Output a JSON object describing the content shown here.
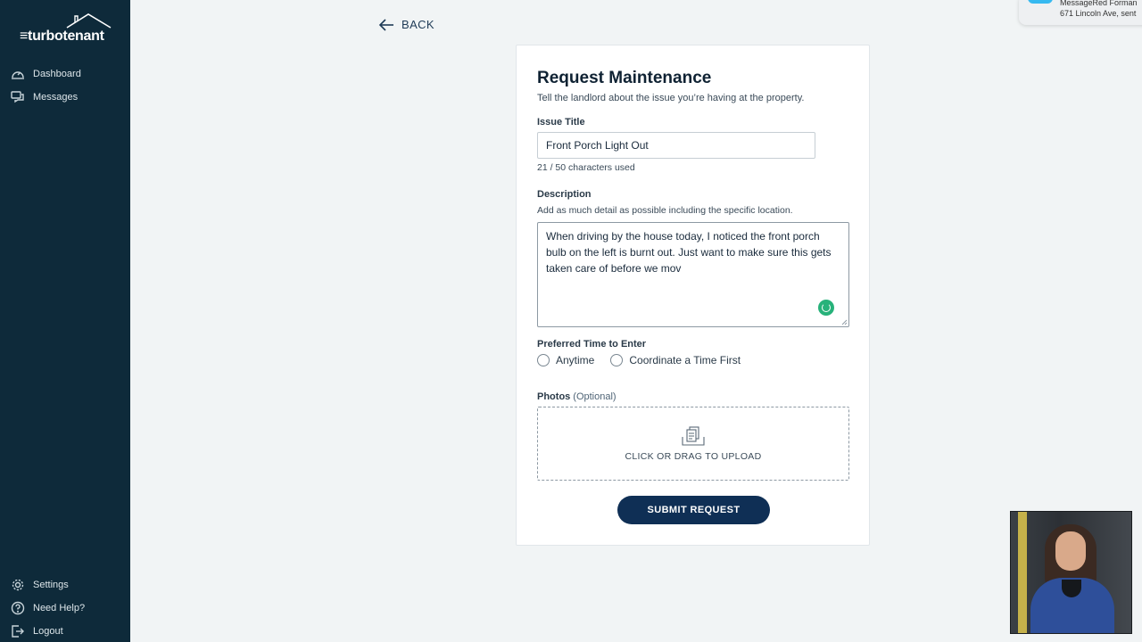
{
  "app": {
    "logo_text": "≡turbotenant"
  },
  "sidebar": {
    "top_items": [
      {
        "label": "Dashboard",
        "icon": "dashboard-icon"
      },
      {
        "label": "Messages",
        "icon": "messages-icon"
      }
    ],
    "bottom_items": [
      {
        "label": "Settings",
        "icon": "gear-icon"
      },
      {
        "label": "Need Help?",
        "icon": "help-icon"
      },
      {
        "label": "Logout",
        "icon": "logout-icon"
      }
    ]
  },
  "back_label": "BACK",
  "form": {
    "title": "Request Maintenance",
    "subtitle": "Tell the landlord about the issue you’re having at the property.",
    "issue_title": {
      "label": "Issue Title",
      "value": "Front Porch Light Out",
      "count": "21 / 50 characters used"
    },
    "description": {
      "label": "Description",
      "helper": "Add as much detail as possible including the specific location.",
      "value": "When driving by the house today, I noticed the front porch bulb on the left is burnt out. Just want to make sure this gets taken care of before we mov"
    },
    "preferred_time": {
      "label": "Preferred Time to Enter",
      "options": [
        "Anytime",
        "Coordinate a Time First"
      ]
    },
    "photos": {
      "label": "Photos",
      "optional": "(Optional)",
      "upload_text": "CLICK OR DRAG TO UPLOAD"
    },
    "submit_label": "SUBMIT REQUEST"
  },
  "notification": {
    "line1": "MessageRed Forman",
    "line2": "671 Lincoln Ave, sent"
  },
  "colors": {
    "sidebar_bg": "#0e2a3a",
    "page_bg": "#f1f4f5",
    "primary": "#0f2f55",
    "grammar_badge": "#27b27a"
  }
}
